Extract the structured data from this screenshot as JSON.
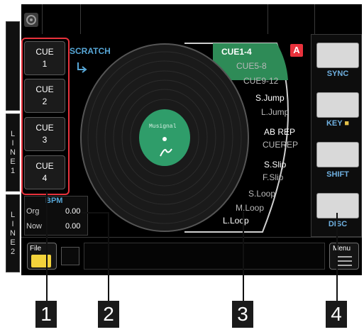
{
  "scratch": {
    "label": "SCRATCH"
  },
  "cue_buttons": [
    {
      "title": "CUE",
      "number": "1"
    },
    {
      "title": "CUE",
      "number": "2"
    },
    {
      "title": "CUE",
      "number": "3"
    },
    {
      "title": "CUE",
      "number": "4"
    }
  ],
  "bank": {
    "active": "CUE1-4",
    "others": [
      "CUE5-8",
      "CUE9-12"
    ],
    "deck_badge": "A"
  },
  "functions": [
    {
      "primary": "S.Jump",
      "secondary": "L.Jump"
    },
    {
      "primary": "AB REP",
      "secondary": "CUEREP"
    },
    {
      "primary": "S.Slip",
      "secondary": "F.Slip"
    }
  ],
  "loops": [
    "S.Loop",
    "M.Loop",
    "L.Loop"
  ],
  "platter": {
    "logo_text": "Musignal"
  },
  "bpm": {
    "label": "BPM",
    "rows": [
      {
        "name": "Org",
        "value": "0.00"
      },
      {
        "name": "Now",
        "value": "0.00"
      }
    ]
  },
  "side_buttons": [
    "SYNC",
    "KEY",
    "SHIFT",
    "DISC"
  ],
  "line_labels": {
    "line1": "LINE1",
    "line2": "LINE2"
  },
  "bottom_bar": {
    "file_label": "File",
    "menu_label": "Menu"
  },
  "callouts": [
    "1",
    "2",
    "3",
    "4"
  ],
  "colors": {
    "cue_highlight": "#e8323c",
    "active_bank": "#2e8b57",
    "accent_blue": "#57a6d6",
    "deck_badge": "#e8323c"
  }
}
